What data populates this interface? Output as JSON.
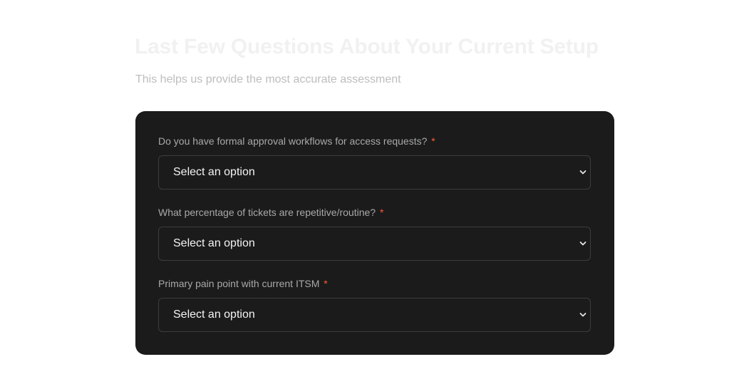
{
  "header": {
    "title": "Last Few Questions About Your Current Setup",
    "subtitle": "This helps us provide the most accurate assessment"
  },
  "form": {
    "fields": [
      {
        "label": "Do you have formal approval workflows for access requests?",
        "required_mark": "*",
        "selected": "Select an option"
      },
      {
        "label": "What percentage of tickets are repetitive/routine?",
        "required_mark": "*",
        "selected": "Select an option"
      },
      {
        "label": "Primary pain point with current ITSM",
        "required_mark": "*",
        "selected": "Select an option"
      }
    ]
  },
  "colors": {
    "card_background": "#1b1b1b",
    "required_accent": "#ff5a36",
    "label_text": "#a9a9a9",
    "title_text": "#f1f1f1"
  },
  "icons": {
    "select_indicator": "chevron-down-icon"
  }
}
